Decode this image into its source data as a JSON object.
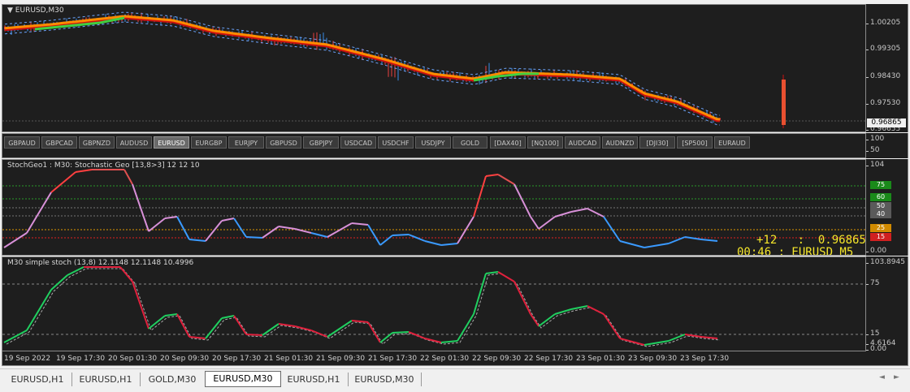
{
  "symbol_title": "EURUSD,M30",
  "price_chart": {
    "scale_ticks": [
      "1.00205",
      "0.99305",
      "0.98430",
      "0.97530",
      "0.96655"
    ],
    "current_price": "0.96865",
    "colors": {
      "bull": "#3b8ee8",
      "bear": "#e84040",
      "ma_orange": "#ff8c00",
      "ma_red": "#cc1010",
      "ma_green": "#40d040"
    }
  },
  "symbol_buttons": [
    "GBPAUD",
    "GBPCAD",
    "GBPNZD",
    "AUDUSD",
    "EURUSD",
    "EURGBP",
    "EURJPY",
    "GBPUSD",
    "GBPJPY",
    "USDCAD",
    "USDCHF",
    "USDJPY",
    "GOLD",
    "[DAX40]",
    "[NQ100]",
    "AUDCAD",
    "AUDNZD",
    "[DJI30]",
    "[SP500]",
    "EURAUD"
  ],
  "active_symbol": "EURUSD",
  "button_scale": [
    "100",
    "50"
  ],
  "stoch_geo": {
    "title": "StochGeo1 : M30: Stochastic Geo [13,8>3]  12 12 10",
    "top_tick": "104",
    "bottom_tick": "0.00",
    "levels": [
      {
        "label": "75",
        "color": "#1a8a1a"
      },
      {
        "label": "60",
        "color": "#1a8a1a"
      },
      {
        "label": "50",
        "color": "#5a5a5a"
      },
      {
        "label": "40",
        "color": "#5a5a5a"
      },
      {
        "label": "25",
        "color": "#d08a00"
      },
      {
        "label": "15",
        "color": "#d02020"
      }
    ],
    "info_line1": "+12   :  0.96865",
    "info_line2": "00:46 : EURUSD M5",
    "info_color": "#f5e62a"
  },
  "simple_stoch": {
    "title": "M30  simple stoch (13,8) 12.1148 12.1148 10.4996",
    "ticks": [
      "103.8945",
      "75",
      "15",
      "4.6164",
      "0.00"
    ]
  },
  "time_axis": [
    "19 Sep 2022",
    "19 Sep 17:30",
    "20 Sep 01:30",
    "20 Sep 09:30",
    "20 Sep 17:30",
    "21 Sep 01:30",
    "21 Sep 09:30",
    "21 Sep 17:30",
    "22 Sep 01:30",
    "22 Sep 09:30",
    "22 Sep 17:30",
    "23 Sep 01:30",
    "23 Sep 09:30",
    "23 Sep 17:30"
  ],
  "tabs": [
    "EURUSD,H1",
    "EURUSD,H1",
    "GOLD,M30",
    "EURUSD,M30",
    "EURUSD,H1",
    "EURUSD,M30"
  ],
  "active_tab_index": 3,
  "tab_nav": {
    "left": "◄",
    "right": "►"
  }
}
